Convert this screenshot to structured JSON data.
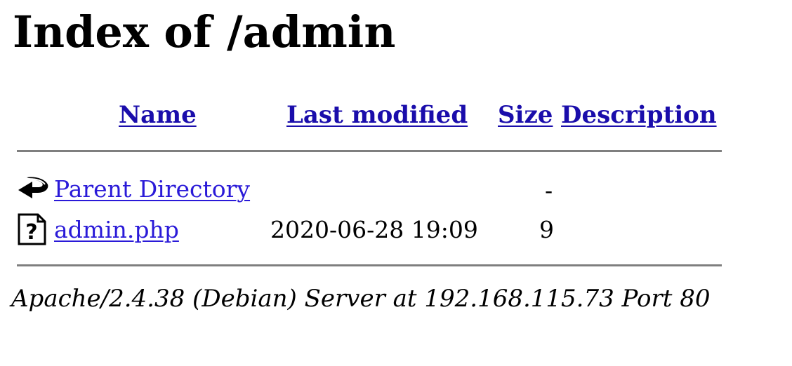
{
  "page": {
    "title": "Index of /admin"
  },
  "table": {
    "headers": {
      "name": "Name",
      "last_modified": "Last modified",
      "size": "Size",
      "description": "Description"
    },
    "rows": [
      {
        "icon": "back-arrow-icon",
        "name": "Parent Directory",
        "last_modified": "",
        "size": "-",
        "description": ""
      },
      {
        "icon": "unknown-file-icon",
        "name": "admin.php",
        "last_modified": "2020-06-28 19:09",
        "size": "9",
        "description": ""
      }
    ]
  },
  "footer": {
    "signature": "Apache/2.4.38 (Debian) Server at 192.168.115.73 Port 80"
  },
  "colors": {
    "link": "#2a1ad8",
    "rule": "#7f7f7f"
  }
}
